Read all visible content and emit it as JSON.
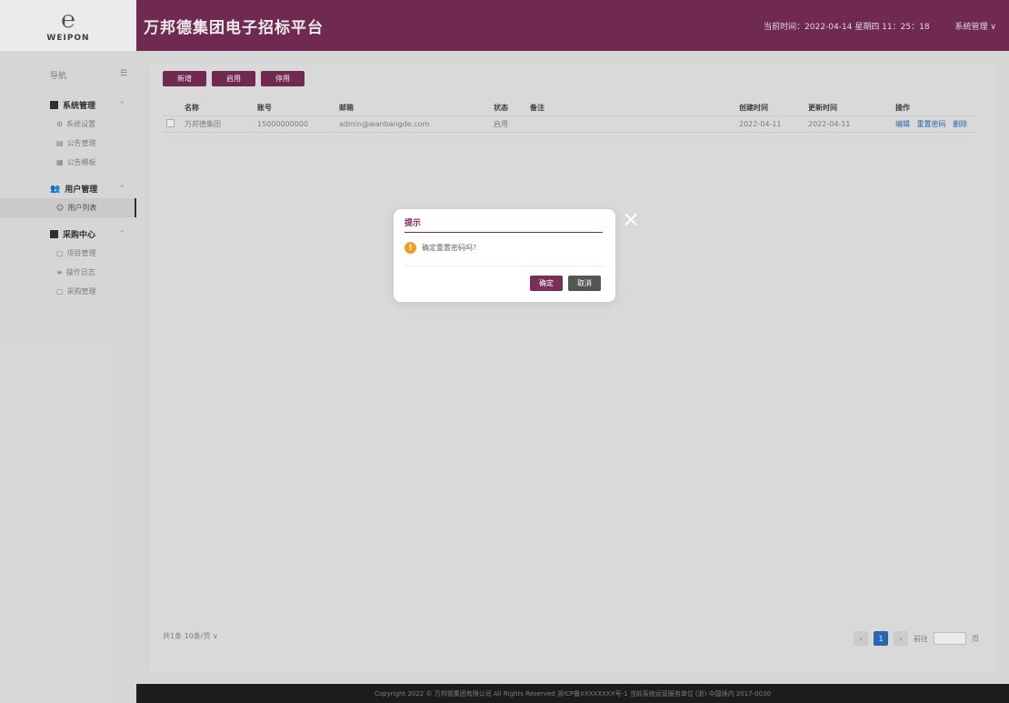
{
  "header": {
    "logo_text": "WEIPON",
    "title": "万邦德集团电子招标平台",
    "time": "当前时间：2022-04-14 星期四 11：25：18",
    "user": "系统管理 ∨"
  },
  "sidebar": {
    "top_label": "导航",
    "top_icon": "☰",
    "groups": [
      {
        "label": "系统管理",
        "items": [
          {
            "label": "系统设置"
          },
          {
            "label": "公告管理"
          },
          {
            "label": "公告模板"
          }
        ]
      },
      {
        "label": "用户管理",
        "items": [
          {
            "label": "用户列表"
          }
        ]
      },
      {
        "label": "采购中心",
        "items": [
          {
            "label": "项目管理"
          },
          {
            "label": "操作日志"
          },
          {
            "label": "采购管理"
          }
        ]
      }
    ]
  },
  "toolbar": {
    "add": "新增",
    "enable": "启用",
    "disable": "停用"
  },
  "table": {
    "headers": {
      "name": "名称",
      "account": "账号",
      "email": "邮箱",
      "status": "状态",
      "note": "备注",
      "created": "创建时间",
      "updated": "更新时间",
      "actions": "操作"
    },
    "rows": [
      {
        "name": "万邦德集团",
        "account": "15000000000",
        "email": "admin@wanbangde.com",
        "status": "启用",
        "note": "",
        "created": "2022-04-11",
        "updated": "2022-04-11",
        "action_edit": "编辑",
        "action_reset": "重置密码",
        "action_delete": "删除"
      }
    ]
  },
  "footer": {
    "total": "共1条  10条/页 ∨",
    "pager_prev": "‹",
    "pager_current": "1",
    "pager_next": "›",
    "pager_goto": "前往",
    "pager_page": "页",
    "copyright": "Copyright 2022 © 万邦德集团有限公司 All Rights Reserved  浙ICP备XXXXXXXX号-1  当前系统运营服务单位  (浙)  中国境内 2017-0030"
  },
  "dialog": {
    "title": "提示",
    "message": "确定重置密码吗？",
    "ok": "确定",
    "cancel": "取消",
    "close": "×"
  },
  "colors": {
    "brand": "#7a2e5a",
    "link": "#2f6ec0",
    "warning": "#f0a020"
  }
}
